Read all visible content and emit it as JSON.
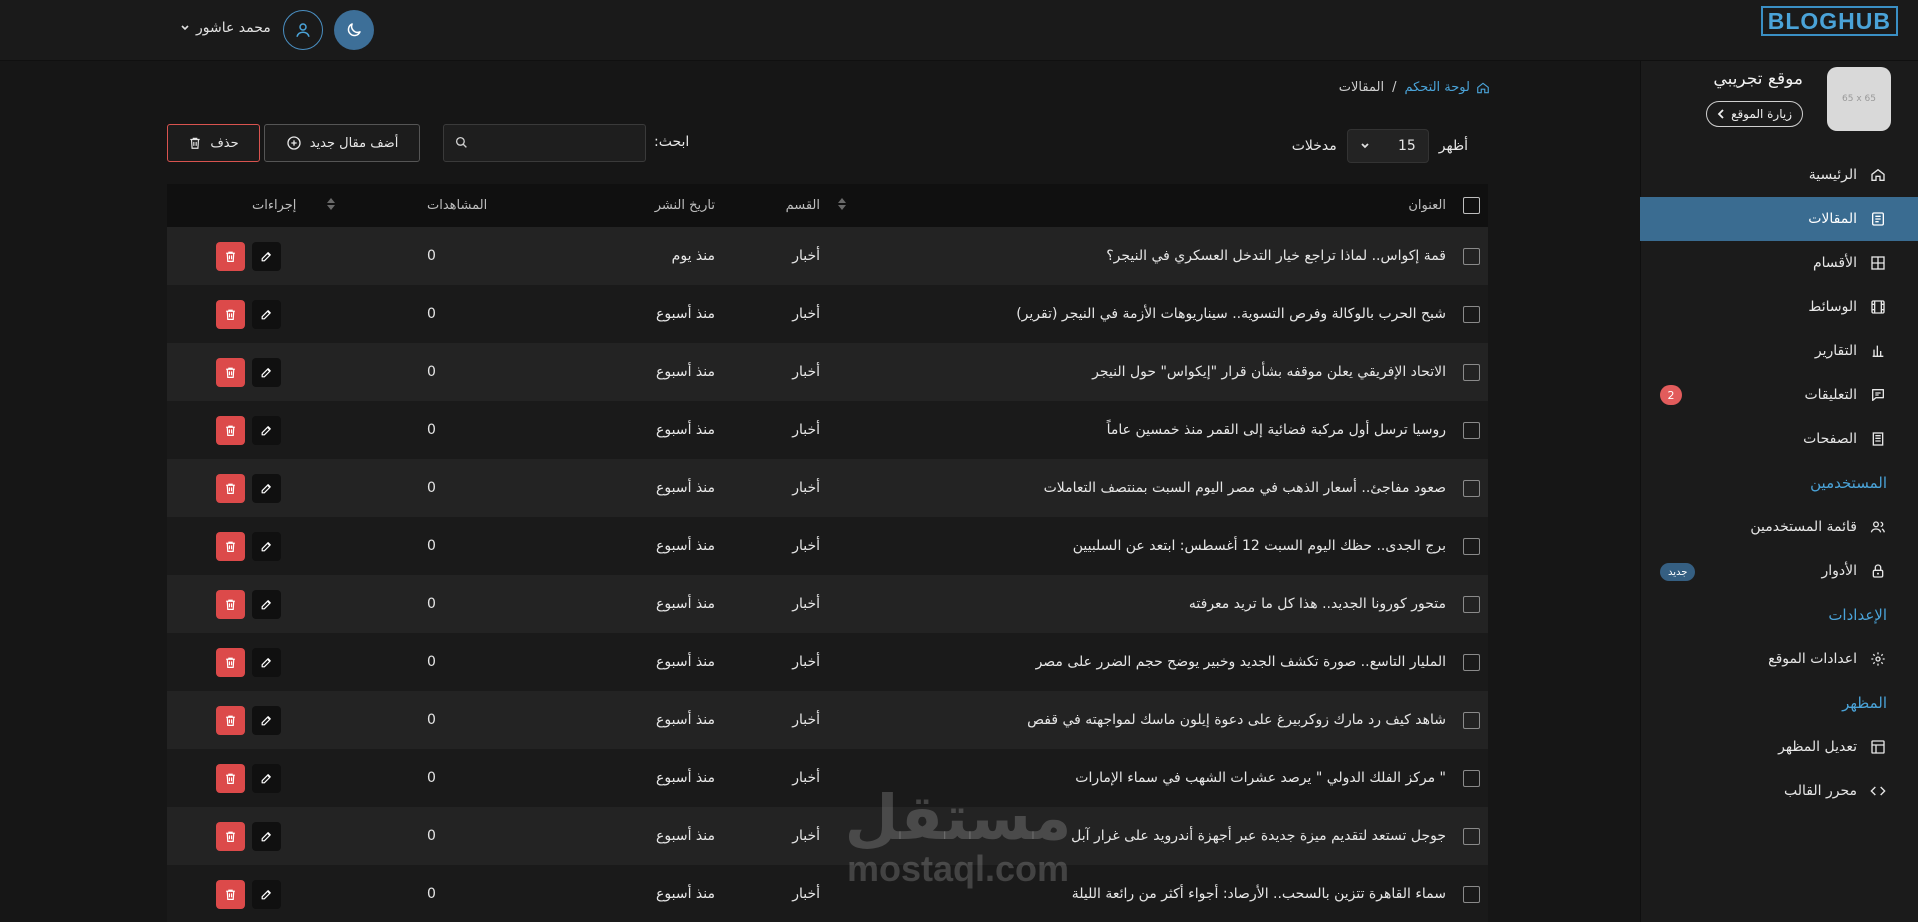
{
  "header": {
    "logo": "BLOGHUB",
    "user_name": "محمد عاشور"
  },
  "sidebar": {
    "site_thumb": "65 x 65",
    "site_name": "موقع تجريبي",
    "visit_label": "زيارة الموقع",
    "items": [
      {
        "label": "الرئيسية",
        "icon": "home-icon"
      },
      {
        "label": "المقالات",
        "icon": "article-icon",
        "active": true
      },
      {
        "label": "الأقسام",
        "icon": "grid-icon"
      },
      {
        "label": "الوسائط",
        "icon": "film-icon"
      },
      {
        "label": "التقارير",
        "icon": "bar-chart-icon"
      },
      {
        "label": "التعليقات",
        "icon": "comment-icon",
        "badge": "2"
      },
      {
        "label": "الصفحات",
        "icon": "pages-icon"
      }
    ],
    "users_section": "المستخدمين",
    "users_items": [
      {
        "label": "قائمة المستخدمين",
        "icon": "users-icon"
      },
      {
        "label": "الأدوار",
        "icon": "lock-icon",
        "badge": "جديد"
      }
    ],
    "settings_section": "الإعدادات",
    "settings_items": [
      {
        "label": "اعدادات الموقع",
        "icon": "gear-icon"
      }
    ],
    "appearance_section": "المظهر",
    "appearance_items": [
      {
        "label": "تعديل المظهر",
        "icon": "layout-icon"
      },
      {
        "label": "محرر القالب",
        "icon": "code-icon"
      }
    ]
  },
  "breadcrumb": {
    "home": "لوحة التحكم",
    "separator": "/",
    "current": "المقالات"
  },
  "toolbar": {
    "show_label": "أظهر",
    "show_value": "15",
    "entries_label": "مدخلات",
    "search_label": "ابحث:",
    "search_value": "",
    "add_label": "أضف مقال جديد",
    "delete_label": "حذف"
  },
  "table": {
    "headers": {
      "title": "العنوان",
      "category": "القسم",
      "date": "تاريخ النشر",
      "views": "المشاهدات",
      "actions": "إجراءات"
    },
    "rows": [
      {
        "title": "قمة إكواس.. لماذا تراجع خيار التدخل العسكري في النيجر؟",
        "category": "أخبار",
        "date": "منذ يوم",
        "views": "0"
      },
      {
        "title": "شبح الحرب بالوكالة وفرص التسوية.. سيناريوهات الأزمة في النيجر (تقرير)",
        "category": "أخبار",
        "date": "منذ أسبوع",
        "views": "0"
      },
      {
        "title": "الاتحاد الإفريقي يعلن موقفه بشأن قرار \"إيكواس\" حول النيجر",
        "category": "أخبار",
        "date": "منذ أسبوع",
        "views": "0"
      },
      {
        "title": "روسيا ترسل أول مركبة فضائية إلى القمر منذ خمسين عاماً",
        "category": "أخبار",
        "date": "منذ أسبوع",
        "views": "0"
      },
      {
        "title": "صعود مفاجئ.. أسعار الذهب في مصر اليوم السبت بمنتصف التعاملات",
        "category": "أخبار",
        "date": "منذ أسبوع",
        "views": "0"
      },
      {
        "title": "برج الجدى.. حظك اليوم السبت 12 أغسطس: ابتعد عن السلبيين",
        "category": "أخبار",
        "date": "منذ أسبوع",
        "views": "0"
      },
      {
        "title": "متحور كورونا الجديد.. هذا كل ما تريد معرفته",
        "category": "أخبار",
        "date": "منذ أسبوع",
        "views": "0"
      },
      {
        "title": "المليار التاسع.. صورة تكشف الجديد وخبير يوضح حجم الضرر على مصر",
        "category": "أخبار",
        "date": "منذ أسبوع",
        "views": "0"
      },
      {
        "title": "شاهد كيف رد مارك زوكربيرغ على دعوة إيلون ماسك لمواجهته في قفص",
        "category": "أخبار",
        "date": "منذ أسبوع",
        "views": "0"
      },
      {
        "title": "\" مركز الفلك الدولي \" يرصد عشرات الشهب في سماء الإمارات",
        "category": "أخبار",
        "date": "منذ أسبوع",
        "views": "0"
      },
      {
        "title": "جوجل تستعد لتقديم ميزة جديدة عبر أجهزة أندرويد على غرار آبل",
        "category": "أخبار",
        "date": "منذ أسبوع",
        "views": "0"
      },
      {
        "title": "سماء القاهرة تتزين بالسحب.. الأرصاد: أجواء أكثر من رائعة الليلة",
        "category": "أخبار",
        "date": "منذ أسبوع",
        "views": "0"
      }
    ]
  },
  "watermark": {
    "arabic": "مستقل",
    "latin": "mostaql.com"
  },
  "colors": {
    "accent": "#3a6c91",
    "link": "#4aa3d8",
    "danger": "#dc4a4a",
    "background": "#161616"
  }
}
